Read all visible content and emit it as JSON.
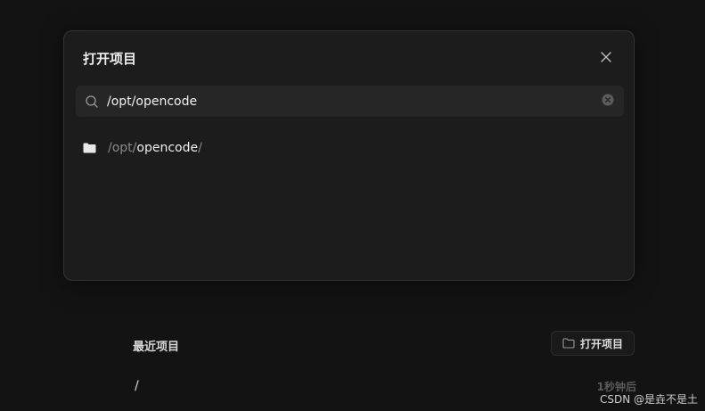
{
  "modal": {
    "title": "打开项目",
    "search": {
      "value": "/opt/opencode",
      "placeholder": ""
    },
    "results": [
      {
        "prefix": "/opt/",
        "name": "opencode",
        "suffix": "/"
      }
    ]
  },
  "recent": {
    "title": "最近项目",
    "open_button_label": "打开项目",
    "items": [
      {
        "path": "/",
        "time": "1秒钟后"
      }
    ]
  },
  "watermark": "CSDN @是垚不是土",
  "icons": {
    "close": "close-icon",
    "search": "search-icon",
    "clear": "clear-circle-icon",
    "folder": "folder-icon",
    "open_folder": "folder-outline-icon"
  },
  "colors": {
    "background": "#131313",
    "modal_background": "#1c1c1c",
    "input_background": "#262626",
    "text_primary": "#eeeeee",
    "text_muted": "#8a8a8a"
  }
}
